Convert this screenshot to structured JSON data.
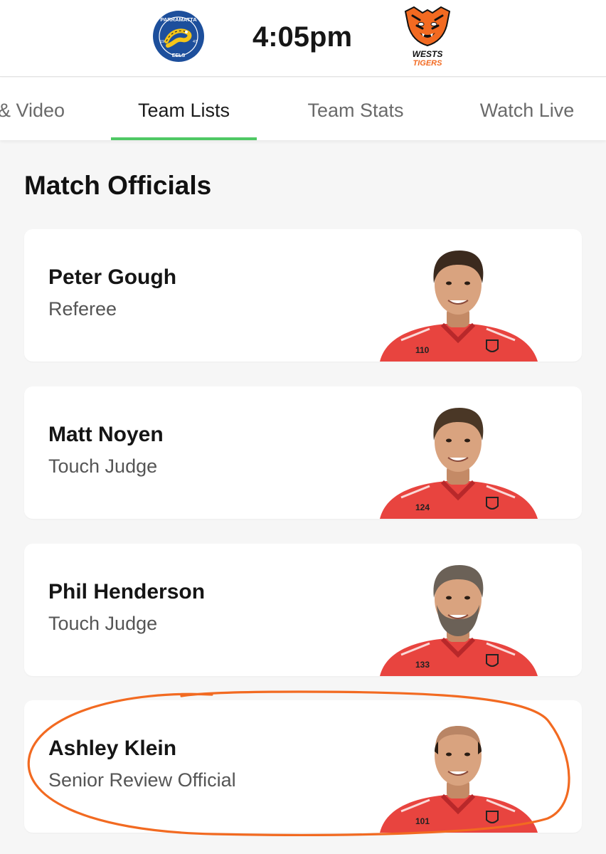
{
  "header": {
    "home_team": {
      "name": "Parramatta Eels",
      "logo_text_top": "PARRAMATTA",
      "logo_text_bottom": "EELS",
      "year_left": "19",
      "year_right": "47",
      "color_primary": "#1d4f9c",
      "color_secondary": "#f5c518"
    },
    "match_time": "4:05pm",
    "away_team": {
      "name": "Wests Tigers",
      "logo_line1": "WESTS",
      "logo_line2": "TIGERS",
      "color_primary": "#f26a21",
      "color_secondary": "#111111"
    }
  },
  "tabs": [
    {
      "label": "& Video",
      "active": false
    },
    {
      "label": "Team Lists",
      "active": true
    },
    {
      "label": "Team Stats",
      "active": false
    },
    {
      "label": "Watch Live",
      "active": false
    }
  ],
  "tab_accent": "#4fc864",
  "section": {
    "title": "Match Officials"
  },
  "officials": [
    {
      "name": "Peter Gough",
      "role": "Referee",
      "jersey_number": "110",
      "hair": "#3b2a1e",
      "beard": false,
      "bald": false
    },
    {
      "name": "Matt Noyen",
      "role": "Touch Judge",
      "jersey_number": "124",
      "hair": "#4a3726",
      "beard": false,
      "bald": false
    },
    {
      "name": "Phil Henderson",
      "role": "Touch Judge",
      "jersey_number": "133",
      "hair": "#6b6157",
      "beard": true,
      "bald": false
    },
    {
      "name": "Ashley Klein",
      "role": "Senior Review Official",
      "jersey_number": "101",
      "hair": "#2a1d14",
      "beard": false,
      "bald": true
    }
  ],
  "highlight": {
    "target": "Ashley Klein",
    "color": "#f26a21"
  },
  "colors": {
    "jersey": "#e8443f",
    "jersey_dark": "#b8282a",
    "background": "#f6f6f6",
    "card": "#ffffff"
  }
}
